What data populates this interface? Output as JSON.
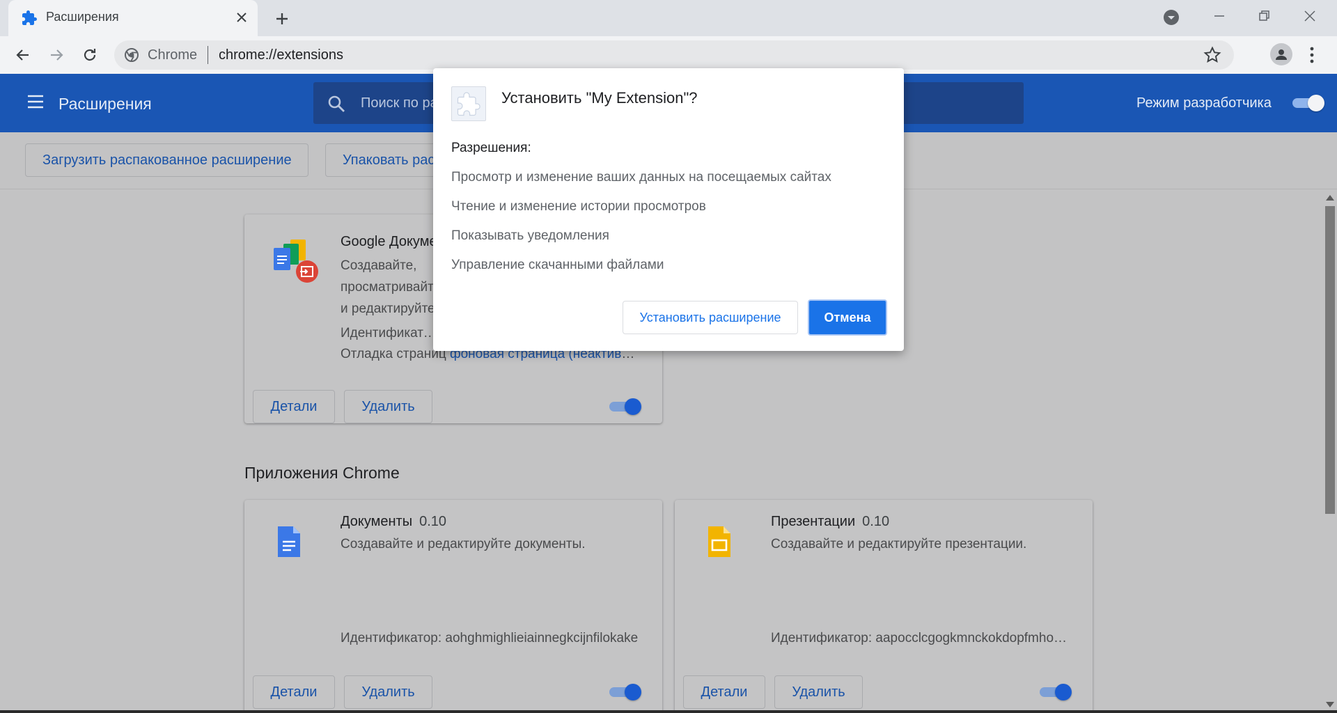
{
  "tab": {
    "title": "Расширения"
  },
  "omnibox": {
    "site": "Chrome",
    "url": "chrome://extensions"
  },
  "header": {
    "title": "Расширения",
    "search_placeholder": "Поиск по расширениям",
    "dev_mode_label": "Режим разработчика",
    "dev_mode_on": true
  },
  "actions": {
    "load_unpacked": "Загрузить распакованное расширение",
    "pack": "Упаковать расширение"
  },
  "extension_card": {
    "name": "Google Документы офлайн",
    "description": "Создавайте, просматривайте и редактируйте документы, таблицы и презентации без доступа к Интернету.",
    "id_text": "Идентификатор: ghbmnnjooekpmoecnnnilnnbdlolhkhi",
    "inspect_prefix": "Отладка страниц ",
    "inspect_link": "фоновая страница (неактивна)",
    "details_label": "Детали",
    "remove_label": "Удалить",
    "enabled": true
  },
  "section_title": "Приложения Chrome",
  "apps": [
    {
      "name": "Документы",
      "version": "0.10",
      "description": "Создавайте и редактируйте документы.",
      "id_text": "Идентификатор: aohghmighlieiainnegkcijnfilokake",
      "details_label": "Детали",
      "remove_label": "Удалить",
      "icon_color": "#3b78e7"
    },
    {
      "name": "Презентации",
      "version": "0.10",
      "description": "Создавайте и редактируйте презентации.",
      "id_text": "Идентификатор: aapocclcgogkmnckokdopfmhonfmgoek",
      "details_label": "Детали",
      "remove_label": "Удалить",
      "icon_color": "#f2b400"
    }
  ],
  "dialog": {
    "title": "Установить \"My Extension\"?",
    "permissions_title": "Разрешения:",
    "permissions": [
      "Просмотр и изменение ваших данных на посещаемых сайтах",
      "Чтение и изменение истории просмотров",
      "Показывать уведомления",
      "Управление скачанными файлами"
    ],
    "install_label": "Установить расширение",
    "cancel_label": "Отмена"
  }
}
